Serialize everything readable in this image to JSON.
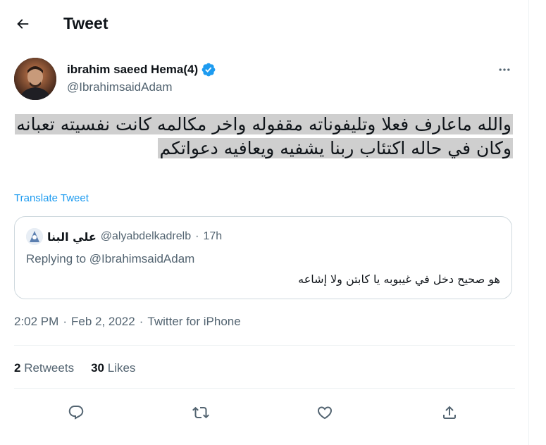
{
  "header": {
    "title": "Tweet",
    "back_icon": "arrow-left-icon"
  },
  "tweet": {
    "author": {
      "name": "ibrahim saeed Hema(4)",
      "handle": "@IbrahimsaidAdam",
      "verified_icon": "verified-badge-icon",
      "verified_color": "#1d9bf0"
    },
    "text": "والله ماعارف فعلا وتليفوناته مقفوله واخر مكالمه كانت نفسيته تعبانه وكان في حاله اكتئاب ربنا يشفيه ويعافيه دعواتكم",
    "translate_label": "Translate Tweet",
    "quote": {
      "name": "علي البنا",
      "handle": "@alyabdelkadrelb",
      "separator": "·",
      "time": "17h",
      "replying_prefix": "Replying to",
      "replying_handle": "@IbrahimsaidAdam",
      "text": "هو صحيح دخل في غيبوبه يا كابتن ولا إشاعه"
    },
    "meta": {
      "time": "2:02 PM",
      "sep1": "·",
      "date": "Feb 2, 2022",
      "sep2": "·",
      "client": "Twitter for iPhone"
    },
    "stats": {
      "retweets_count": "2",
      "retweets_label": "Retweets",
      "likes_count": "30",
      "likes_label": "Likes"
    },
    "actions": [
      "reply-icon",
      "retweet-icon",
      "like-icon",
      "share-icon"
    ]
  },
  "colors": {
    "accent": "#1d9bf0",
    "secondary_text": "#536471",
    "highlight": "#cfcfcf"
  }
}
